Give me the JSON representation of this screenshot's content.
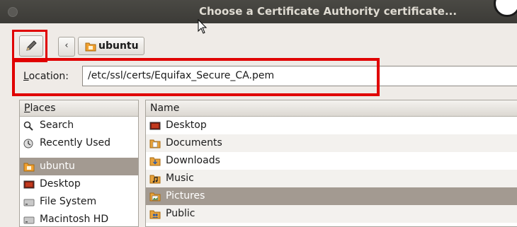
{
  "window": {
    "title": "Choose a Certificate Authority certificate..."
  },
  "toolbar": {
    "back_label": "‹",
    "crumb_label": "ubuntu"
  },
  "location": {
    "label_mnemonic": "L",
    "label_rest": "ocation:",
    "value": "/etc/ssl/certs/Equifax_Secure_CA.pem"
  },
  "places": {
    "header_mnemonic": "P",
    "header_rest": "laces",
    "items": [
      {
        "label": "Search",
        "icon": "search-icon"
      },
      {
        "label": "Recently Used",
        "icon": "recent-icon"
      },
      {
        "label": "ubuntu",
        "icon": "home-folder-icon",
        "selected": true
      },
      {
        "label": "Desktop",
        "icon": "desktop-icon"
      },
      {
        "label": "File System",
        "icon": "drive-icon"
      },
      {
        "label": "Macintosh HD",
        "icon": "drive-icon"
      }
    ]
  },
  "files": {
    "header": "Name",
    "rows": [
      {
        "label": "Desktop",
        "icon": "desktop-icon"
      },
      {
        "label": "Documents",
        "icon": "documents-folder-icon"
      },
      {
        "label": "Downloads",
        "icon": "downloads-folder-icon"
      },
      {
        "label": "Music",
        "icon": "music-folder-icon"
      },
      {
        "label": "Pictures",
        "icon": "pictures-folder-icon",
        "selected": true
      },
      {
        "label": "Public",
        "icon": "public-folder-icon"
      }
    ]
  },
  "colors": {
    "highlight_box": "#e00000",
    "selection": "#a39a91",
    "titlebar": "#3c3b37"
  }
}
